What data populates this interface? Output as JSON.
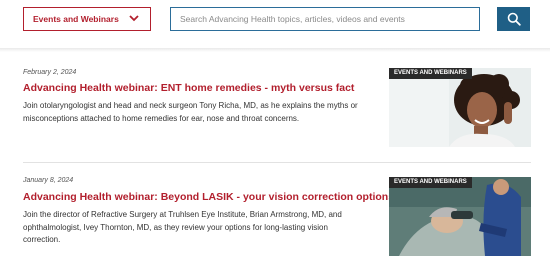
{
  "header": {
    "category_select": {
      "label": "Events and Webinars"
    },
    "search": {
      "placeholder": "Search Advancing Health topics, articles, videos and events"
    },
    "search_button_icon": "magnifier-icon"
  },
  "articles": [
    {
      "date": "February 2, 2024",
      "title": "Advancing Health webinar: ENT home remedies - myth versus fact",
      "description": "Join otolaryngologist and head and neck surgeon Tony Richa, MD, as he explains the myths or misconceptions attached to home remedies for ear, nose and throat concerns.",
      "badge": "EVENTS AND WEBINARS"
    },
    {
      "date": "January 8, 2024",
      "title": "Advancing Health webinar: Beyond LASIK - your vision correction options",
      "description": "Join the director of Refractive Surgery at Truhlsen Eye Institute, Brian Armstrong, MD, and ophthalmologist, Ivey Thornton, MD, as they review your options for long-lasting vision correction.",
      "badge": "EVENTS AND WEBINARS"
    }
  ],
  "colors": {
    "accent": "#b21f2d",
    "search_border": "#2b6d99",
    "search_button": "#1f5f86"
  }
}
